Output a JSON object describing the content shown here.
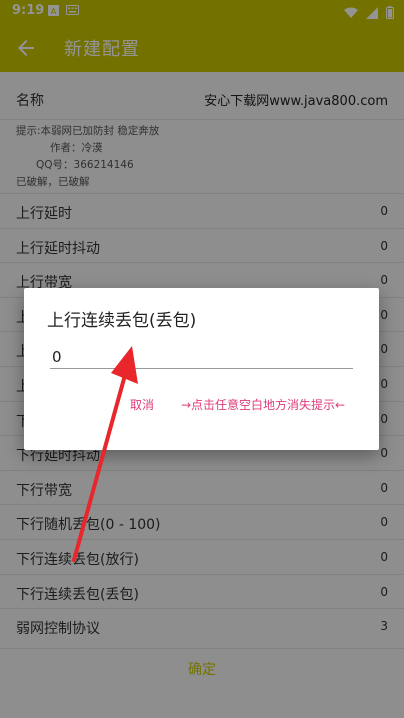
{
  "status": {
    "time": "9:19",
    "colors": {
      "bar": "#c6c300"
    }
  },
  "appbar": {
    "title": "新建配置",
    "back_icon": "arrow-left-icon"
  },
  "name_row": {
    "label": "名称",
    "value": "安心下载网www.java800.com"
  },
  "hint": {
    "line1": "提示:本弱网已加防封 稳定奔放",
    "line2": "作者：冷漠",
    "line3": "QQ号：366214146",
    "line4": "已破解，已破解"
  },
  "items": [
    {
      "label": "上行延时",
      "value": "0"
    },
    {
      "label": "上行延时抖动",
      "value": "0"
    },
    {
      "label": "上行带宽",
      "value": "0"
    },
    {
      "label": "上",
      "value": "0"
    },
    {
      "label": "上",
      "value": "0"
    },
    {
      "label": "上",
      "value": "0"
    },
    {
      "label": "下",
      "value": "0"
    },
    {
      "label": "下行延时抖动",
      "value": "0"
    },
    {
      "label": "下行带宽",
      "value": "0"
    },
    {
      "label": "下行随机丢包(0 - 100)",
      "value": "0"
    },
    {
      "label": "下行连续丢包(放行)",
      "value": "0"
    },
    {
      "label": "下行连续丢包(丢包)",
      "value": "0"
    },
    {
      "label": "弱网控制协议",
      "value": "3"
    }
  ],
  "confirm": {
    "label": "确定"
  },
  "dialog": {
    "title": "上行连续丢包(丢包)",
    "input_value": "0",
    "cancel_label": "取消",
    "tip_label": "→点击任意空白地方消失提示←"
  },
  "colors": {
    "accent": "#c6c300",
    "dialog_button": "#e03b7c",
    "annotation_arrow": "#e8262b"
  }
}
